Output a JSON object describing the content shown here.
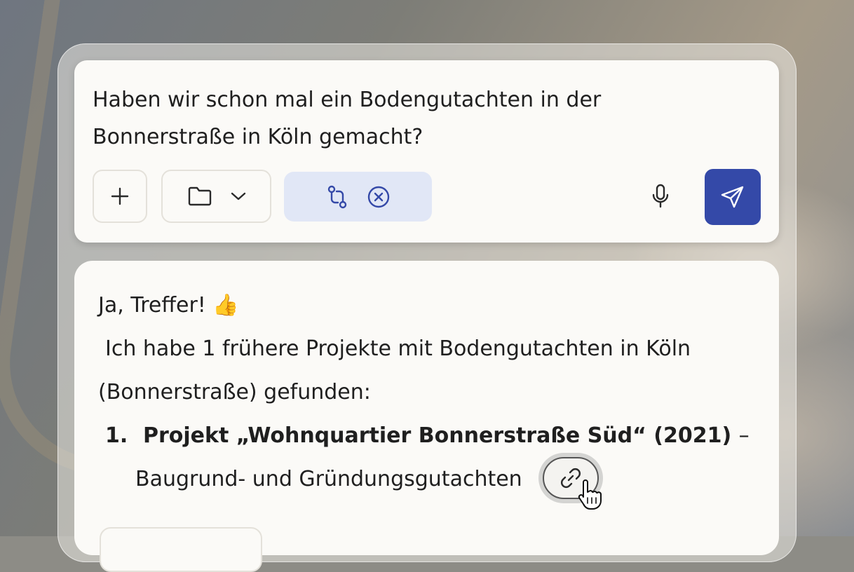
{
  "composer": {
    "question": "Haben wir schon mal ein Bodengutachten in der Bonnerstraße in Köln gemacht?",
    "icons": {
      "add": "plus-icon",
      "folder": "folder-icon",
      "chevron": "chevron-down-icon",
      "source": "git-compare-icon",
      "remove": "close-circle-icon",
      "mic": "microphone-icon",
      "send": "send-icon"
    }
  },
  "answer": {
    "greeting": "Ja, Treffer! 👍",
    "intro": "Ich habe 1 frühere Projekte mit Bodengutachten in Köln",
    "intro_cont": "(Bonnerstraße) gefunden:",
    "results": [
      {
        "number": "1.",
        "title": "Projekt „Wohnquartier Bonnerstraße Süd“ (2021)",
        "separator": "–",
        "subtitle": "Baugrund- und Gründungsgutachten"
      }
    ]
  },
  "colors": {
    "accent": "#3449a8",
    "chip": "#e1e7f6",
    "card": "#fbfaf7"
  }
}
